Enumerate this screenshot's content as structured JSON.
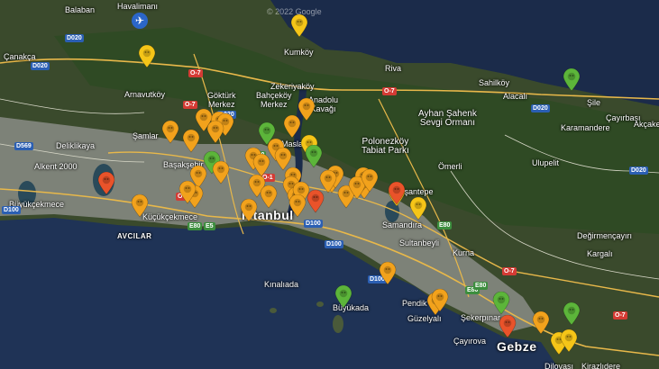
{
  "map": {
    "copyright": "© 2022 Google",
    "colors": {
      "sea": "#1b2b4a",
      "land_dark": "#3a4a2c",
      "land_forest": "#2f4a24",
      "urban": "#8a8c86",
      "road_major": "#e8b84a",
      "road_minor": "#d8d8c8",
      "marker_orange": "#f2a21c",
      "marker_yellow": "#f5c518",
      "marker_red": "#e9532a",
      "marker_green": "#5cb53a"
    },
    "places": [
      {
        "name": "Balaban",
        "style": "mid"
      },
      {
        "name": "Havalimanı",
        "style": "mid"
      },
      {
        "name": "Kumköy",
        "style": "mid"
      },
      {
        "name": "Çanakça",
        "style": "mid"
      },
      {
        "name": "Arnavutköy",
        "style": "mid"
      },
      {
        "name": "Göktürk\nMerkez",
        "style": "mid"
      },
      {
        "name": "Zekeriyaköy",
        "style": "mid"
      },
      {
        "name": "Bahçeköy\nMerkez",
        "style": "mid"
      },
      {
        "name": "Anadolu\nKavağı",
        "style": "mid"
      },
      {
        "name": "Riva",
        "style": "mid"
      },
      {
        "name": "Sahilköy",
        "style": "mid"
      },
      {
        "name": "Alacalı",
        "style": "mid"
      },
      {
        "name": "Şile",
        "style": "mid"
      },
      {
        "name": "Çayırbaşı",
        "style": "mid"
      },
      {
        "name": "Karamandere",
        "style": "mid"
      },
      {
        "name": "Akçakese",
        "style": "mid"
      },
      {
        "name": "Ayhan Şahenk\nSevgi Ormanı",
        "style": "mid"
      },
      {
        "name": "Polonezköy\nTabiat Parkı",
        "style": "mid"
      },
      {
        "name": "Ömerli",
        "style": "mid"
      },
      {
        "name": "Ulupelit",
        "style": "mid"
      },
      {
        "name": "Şamlar",
        "style": "mid"
      },
      {
        "name": "Deliklikaya",
        "style": "mid"
      },
      {
        "name": "Alkent 2000",
        "style": "mid"
      },
      {
        "name": "Başakşehir",
        "style": "mid"
      },
      {
        "name": "Maslak",
        "style": "mid"
      },
      {
        "name": "Büyükçekmece",
        "style": "mid"
      },
      {
        "name": "Küçükçekmece",
        "style": "mid"
      },
      {
        "name": "AVCILAR",
        "style": "caps"
      },
      {
        "name": "İstanbul",
        "style": "big"
      },
      {
        "name": "Nişantepe",
        "style": "mid"
      },
      {
        "name": "Samandıra",
        "style": "mid"
      },
      {
        "name": "Sultanbeyli",
        "style": "mid"
      },
      {
        "name": "Kurna",
        "style": "mid"
      },
      {
        "name": "Değirmençayırı",
        "style": "mid"
      },
      {
        "name": "Kargalı",
        "style": "mid"
      },
      {
        "name": "Kınalıada",
        "style": "mid"
      },
      {
        "name": "Büyükada",
        "style": "mid"
      },
      {
        "name": "Pendik",
        "style": "mid"
      },
      {
        "name": "Güzelyalı",
        "style": "mid"
      },
      {
        "name": "Şekerpınar",
        "style": "mid"
      },
      {
        "name": "Çayırova",
        "style": "mid"
      },
      {
        "name": "Gebze",
        "style": "big"
      },
      {
        "name": "Dilovası",
        "style": "mid"
      },
      {
        "name": "Kirazlıdere",
        "style": "mid"
      }
    ],
    "road_shields": [
      {
        "text": "D020",
        "color": "blue"
      },
      {
        "text": "D020",
        "color": "blue"
      },
      {
        "text": "O-7",
        "color": "red"
      },
      {
        "text": "D020",
        "color": "blue"
      },
      {
        "text": "O-7",
        "color": "red"
      },
      {
        "text": "D569",
        "color": "blue"
      },
      {
        "text": "E80",
        "color": "green"
      },
      {
        "text": "O-1",
        "color": "red"
      },
      {
        "text": "O-7",
        "color": "red"
      },
      {
        "text": "D100",
        "color": "blue"
      },
      {
        "text": "E80",
        "color": "green"
      },
      {
        "text": "E5",
        "color": "green"
      },
      {
        "text": "D100",
        "color": "blue"
      },
      {
        "text": "D100",
        "color": "blue"
      },
      {
        "text": "O-7",
        "color": "red"
      },
      {
        "text": "D020",
        "color": "blue"
      },
      {
        "text": "D020",
        "color": "blue"
      },
      {
        "text": "E80",
        "color": "green"
      },
      {
        "text": "D100",
        "color": "blue"
      },
      {
        "text": "E80",
        "color": "green"
      },
      {
        "text": "O-7",
        "color": "red"
      },
      {
        "text": "O-7",
        "color": "red"
      },
      {
        "text": "E80",
        "color": "green"
      }
    ],
    "markers": [
      {
        "level": "yellow"
      },
      {
        "level": "yellow"
      },
      {
        "level": "orange"
      },
      {
        "level": "orange"
      },
      {
        "level": "orange"
      },
      {
        "level": "orange"
      },
      {
        "level": "orange"
      },
      {
        "level": "orange"
      },
      {
        "level": "green"
      },
      {
        "level": "orange"
      },
      {
        "level": "orange"
      },
      {
        "level": "yellow"
      },
      {
        "level": "orange"
      },
      {
        "level": "green"
      },
      {
        "level": "orange"
      },
      {
        "level": "orange"
      },
      {
        "level": "orange"
      },
      {
        "level": "orange"
      },
      {
        "level": "orange"
      },
      {
        "level": "orange"
      },
      {
        "level": "orange"
      },
      {
        "level": "orange"
      },
      {
        "level": "orange"
      },
      {
        "level": "orange"
      },
      {
        "level": "red"
      },
      {
        "level": "orange"
      },
      {
        "level": "orange"
      },
      {
        "level": "orange"
      },
      {
        "level": "red"
      },
      {
        "level": "orange"
      },
      {
        "level": "orange"
      },
      {
        "level": "yellow"
      },
      {
        "level": "yellow"
      },
      {
        "level": "orange"
      },
      {
        "level": "orange"
      },
      {
        "level": "green"
      },
      {
        "level": "red"
      },
      {
        "level": "orange"
      },
      {
        "level": "orange"
      },
      {
        "level": "green"
      },
      {
        "level": "orange"
      },
      {
        "level": "orange"
      },
      {
        "level": "orange"
      },
      {
        "level": "orange"
      },
      {
        "level": "yellow"
      },
      {
        "level": "yellow"
      },
      {
        "level": "green"
      },
      {
        "level": "orange"
      },
      {
        "level": "green"
      },
      {
        "level": "green"
      },
      {
        "level": "red"
      },
      {
        "level": "orange"
      },
      {
        "level": "orange"
      },
      {
        "level": "orange"
      },
      {
        "level": "orange"
      }
    ]
  }
}
